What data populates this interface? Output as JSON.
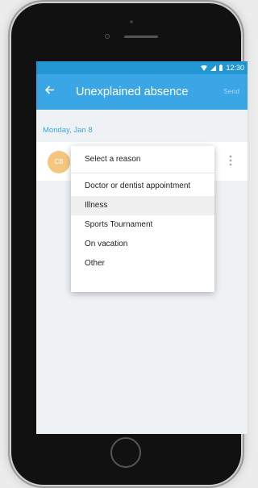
{
  "status_bar": {
    "time": "12:30",
    "icons": [
      "wifi-icon",
      "signal-icon",
      "battery-icon"
    ]
  },
  "app_bar": {
    "title": "Unexplained absence",
    "action": "Send",
    "back_icon": "arrow-left-icon"
  },
  "date_label": "Monday, Jan 8",
  "card": {
    "avatar_text": "CB",
    "more_icon": "more-vertical-icon"
  },
  "reason_menu": {
    "header": "Select a reason",
    "items": [
      "Doctor or dentist appointment",
      "Illness",
      "Sports Tournament",
      "On vacation",
      "Other"
    ],
    "selected": "Illness"
  },
  "colors": {
    "app_bar": "#3aa6e6",
    "status_bar": "#2196d3",
    "accent_text": "#3aa6e6",
    "avatar": "#f5c77e",
    "background": "#eef2f5"
  }
}
